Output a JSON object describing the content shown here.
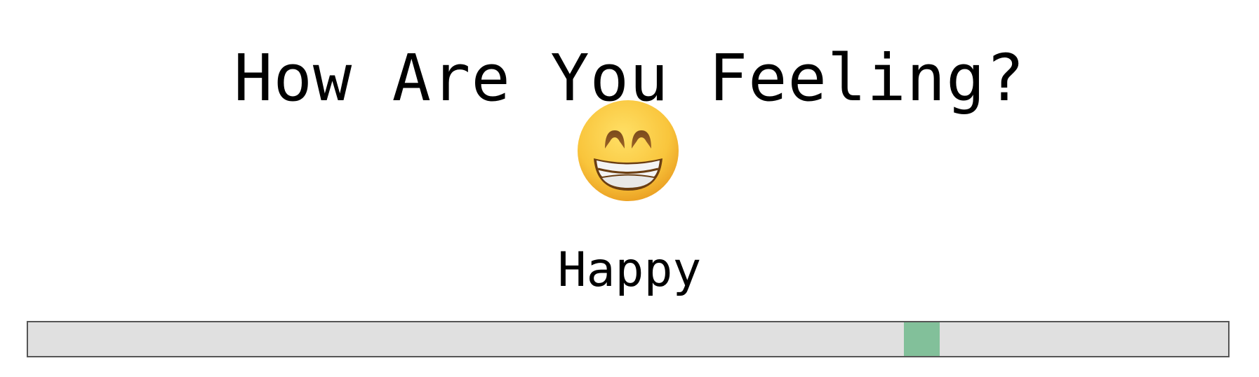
{
  "title": "How Are You Feeling?",
  "mood": {
    "emoji_icon": "grinning-face-with-smiling-eyes-icon",
    "label": "Happy"
  },
  "slider": {
    "value_fraction": 0.745,
    "track_color": "#e0e0e0",
    "border_color": "#555555",
    "thumb_color": "#82c09a"
  }
}
